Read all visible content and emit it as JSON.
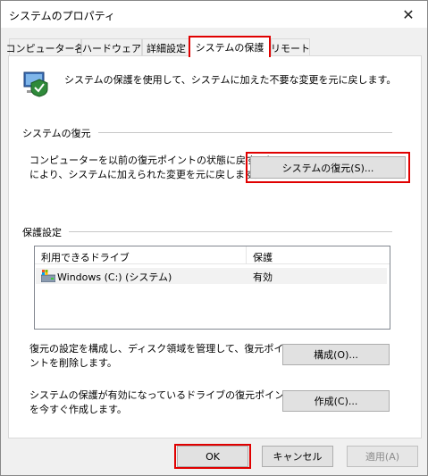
{
  "window": {
    "title": "システムのプロパティ"
  },
  "tabs": [
    {
      "label": "コンピューター名"
    },
    {
      "label": "ハードウェア"
    },
    {
      "label": "詳細設定"
    },
    {
      "label": "システムの保護"
    },
    {
      "label": "リモート"
    }
  ],
  "intro_text": "システムの保護を使用して、システムに加えた不要な変更を元に戻します。",
  "restore": {
    "title": "システムの復元",
    "desc_line1": "コンピューターを以前の復元ポイントの状態に戻すこと",
    "desc_line2": "により、システムに加えられた変更を元に戻します。",
    "button": "システムの復元(S)..."
  },
  "protection": {
    "title": "保護設定",
    "columns": {
      "drive": "利用できるドライブ",
      "protection": "保護"
    },
    "rows": [
      {
        "drive": "Windows (C:) (システム)",
        "protection": "有効"
      }
    ],
    "configure_desc_line1": "復元の設定を構成し、ディスク領域を管理して、復元ポイ",
    "configure_desc_line2": "ントを削除します。",
    "configure_button": "構成(O)...",
    "create_desc_line1": "システムの保護が有効になっているドライブの復元ポイント",
    "create_desc_line2": "を今すぐ作成します。",
    "create_button": "作成(C)..."
  },
  "buttons": {
    "ok": "OK",
    "cancel": "キャンセル",
    "apply": "適用(A)"
  },
  "colors": {
    "highlight": "#e00000",
    "button_face": "#e1e1e1",
    "window_bg": "#f0f0f0"
  },
  "icons": {
    "close": "close-icon",
    "system_protection": "system-protection-icon",
    "drive": "drive-icon"
  }
}
